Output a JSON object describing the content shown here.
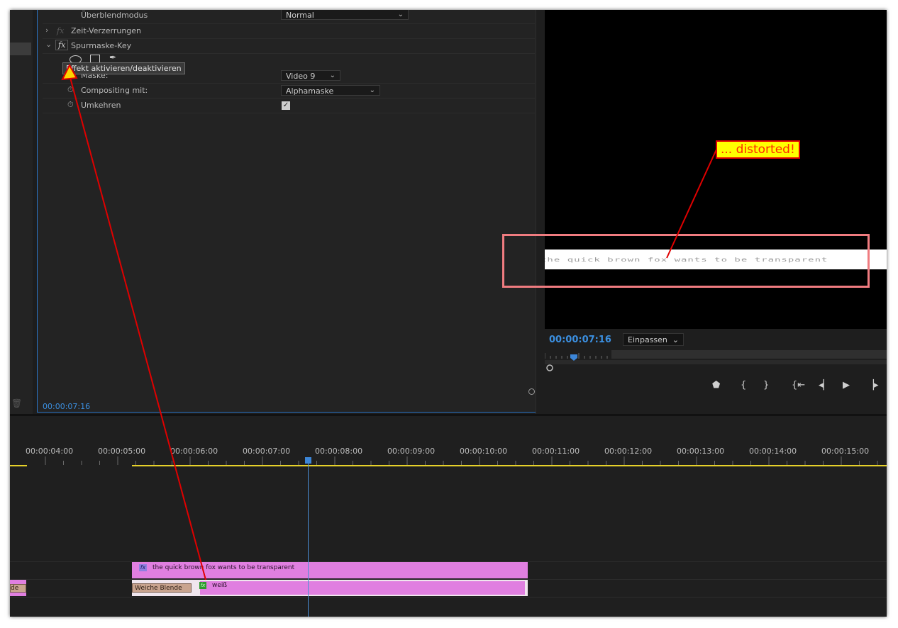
{
  "effect_controls": {
    "blend_mode_label": "Überblendmodus",
    "blend_mode_value": "Normal",
    "time_remap_label": "Zeit-Verzerrungen",
    "track_matte_label": "Spurmaske-Key",
    "tooltip": "Effekt aktivieren/deaktivieren",
    "mask_label": "Maske:",
    "mask_value": "Video 9",
    "composite_label": "Compositing mit:",
    "composite_value": "Alphamaske",
    "reverse_label": "Umkehren",
    "reverse_checked": true,
    "timecode": "00:00:07:16"
  },
  "program_monitor": {
    "timecode": "00:00:07:16",
    "fit_value": "Einpassen",
    "frame_text": "the quick brown fox wants to be transparent"
  },
  "timeline": {
    "ruler": [
      "00:00:04:00",
      "00:00:05:00",
      "00:00:06:00",
      "00:00:07:00",
      "00:00:08:00",
      "00:00:09:00",
      "00:00:10:00",
      "00:00:11:00",
      "00:00:12:00",
      "00:00:13:00",
      "00:00:14:00",
      "00:00:15:00"
    ],
    "clip_text_label": "the quick brown fox wants to be transparent",
    "clip_white_label": "weiß",
    "transition_label": "Weiche Blende",
    "left_clip_label": "de"
  },
  "annotation": {
    "callout_text": "... distorted!"
  },
  "colors": {
    "accent_blue": "#3b8fe0",
    "clip_pink": "#e07fe0",
    "work_area_yellow": "#e6d12a",
    "callout_red": "#e00000",
    "callout_yellow": "#ffff00"
  }
}
